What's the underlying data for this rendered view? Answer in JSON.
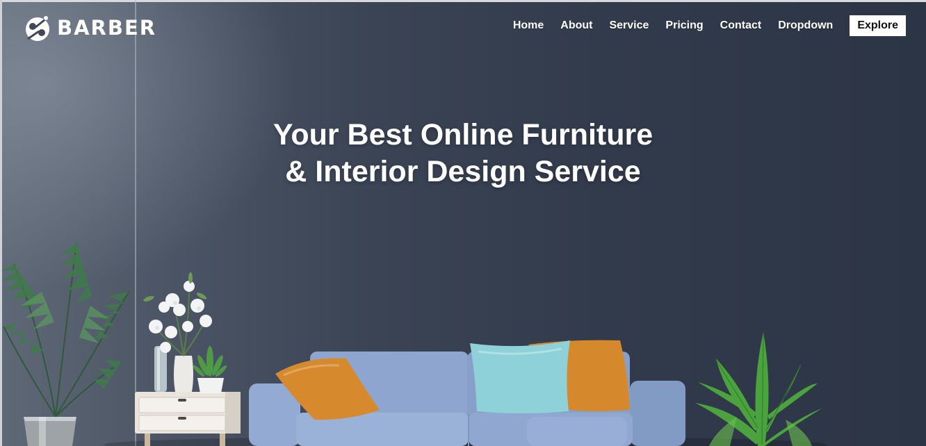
{
  "brand": {
    "name": "BARBER",
    "logo_icon": "barber-scissors-logo"
  },
  "nav": {
    "items": [
      {
        "label": "Home"
      },
      {
        "label": "About"
      },
      {
        "label": "Service"
      },
      {
        "label": "Pricing"
      },
      {
        "label": "Contact"
      },
      {
        "label": "Dropdown"
      }
    ],
    "cta_label": "Explore"
  },
  "hero": {
    "title_line1": "Your Best Online Furniture",
    "title_line2": "& Interior Design Service"
  },
  "colors": {
    "wall": "#3b4455",
    "sofa": "#8fa7cf",
    "pillow_orange": "#d88a2e",
    "pillow_teal": "#8ccfd6"
  }
}
